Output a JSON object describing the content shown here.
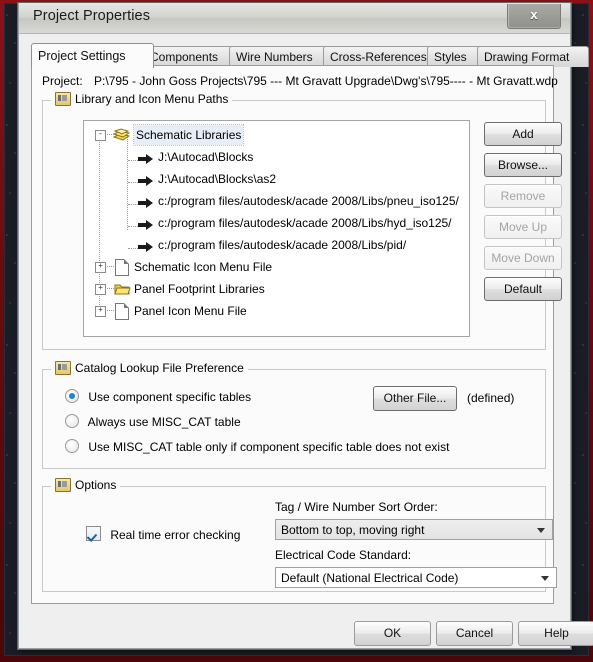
{
  "window": {
    "title": "Project Properties",
    "close_label": "x",
    "close_icon": "close-icon"
  },
  "tabs": [
    {
      "label": "Project Settings",
      "active": true
    },
    {
      "label": "Components",
      "active": false
    },
    {
      "label": "Wire Numbers",
      "active": false
    },
    {
      "label": "Cross-References",
      "active": false
    },
    {
      "label": "Styles",
      "active": false
    },
    {
      "label": "Drawing Format",
      "active": false
    }
  ],
  "project": {
    "label": "Project:",
    "path": "P:\\795 - John Goss Projects\\795 --- Mt Gravatt Upgrade\\Dwg's\\795---- - Mt Gravatt.wdp"
  },
  "library_group": {
    "title": "Library and Icon Menu Paths",
    "icon": "library-icon",
    "tree": [
      {
        "label": "Schematic Libraries",
        "icon": "books-icon",
        "expander": "-",
        "level": 0,
        "selected": true
      },
      {
        "label": "J:\\Autocad\\Blocks",
        "icon": "arrow-icon",
        "expander": "",
        "level": 1,
        "selected": false
      },
      {
        "label": "J:\\Autocad\\Blocks\\as2",
        "icon": "arrow-icon",
        "expander": "",
        "level": 1,
        "selected": false
      },
      {
        "label": "c:/program files/autodesk/acade 2008/Libs/pneu_iso125/",
        "icon": "arrow-icon",
        "expander": "",
        "level": 1,
        "selected": false
      },
      {
        "label": "c:/program files/autodesk/acade 2008/Libs/hyd_iso125/",
        "icon": "arrow-icon",
        "expander": "",
        "level": 1,
        "selected": false
      },
      {
        "label": "c:/program files/autodesk/acade 2008/Libs/pid/",
        "icon": "arrow-icon",
        "expander": "",
        "level": 1,
        "selected": false
      },
      {
        "label": "Schematic Icon Menu File",
        "icon": "page-icon",
        "expander": "+",
        "level": 0,
        "selected": false
      },
      {
        "label": "Panel Footprint Libraries",
        "icon": "folder-icon",
        "expander": "+",
        "level": 0,
        "selected": false
      },
      {
        "label": "Panel Icon Menu File",
        "icon": "page-icon",
        "expander": "+",
        "level": 0,
        "selected": false
      }
    ],
    "buttons": [
      {
        "label": "Add",
        "enabled": true,
        "strong": true
      },
      {
        "label": "Browse...",
        "enabled": true,
        "strong": true
      },
      {
        "label": "Remove",
        "enabled": false,
        "strong": false
      },
      {
        "label": "Move Up",
        "enabled": false,
        "strong": false
      },
      {
        "label": "Move Down",
        "enabled": false,
        "strong": false
      },
      {
        "label": "Default",
        "enabled": true,
        "strong": true
      }
    ]
  },
  "catalog_group": {
    "title": "Catalog Lookup File Preference",
    "icon": "catalog-icon",
    "options": [
      {
        "label": "Use component specific tables",
        "selected": true
      },
      {
        "label": "Always use MISC_CAT table",
        "selected": false
      },
      {
        "label": "Use MISC_CAT table only if component specific table does not exist",
        "selected": false
      }
    ],
    "other_file_button": "Other File...",
    "defined_text": "(defined)"
  },
  "options_group": {
    "title": "Options",
    "icon": "options-icon",
    "realtime_check": {
      "label": "Real time error checking",
      "checked": true
    },
    "sort_order": {
      "label": "Tag / Wire Number Sort Order:",
      "value": "Bottom to top, moving right"
    },
    "code_standard": {
      "label": "Electrical Code Standard:",
      "value": "Default (National Electrical Code)"
    }
  },
  "footer": {
    "ok": "OK",
    "cancel": "Cancel",
    "help": "Help"
  }
}
